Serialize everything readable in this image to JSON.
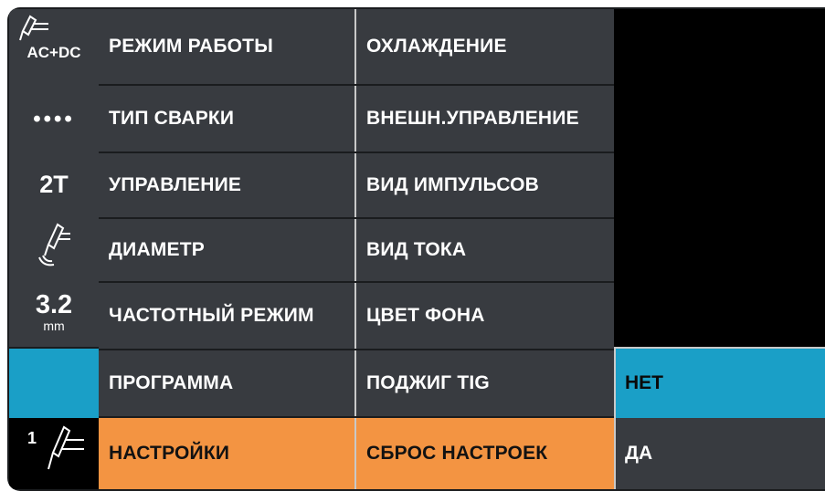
{
  "sidebar": {
    "mode_label": "AC+DC",
    "dots_label": "••••",
    "trigger_label": "2T",
    "diameter_value": "3.2",
    "diameter_unit": "mm",
    "program_number": "1"
  },
  "menu": {
    "col1": [
      "РЕЖИМ РАБОТЫ",
      "ТИП СВАРКИ",
      "УПРАВЛЕНИЕ",
      "ДИАМЕТР",
      "ЧАСТОТНЫЙ РЕЖИМ",
      "ПРОГРАММА",
      "НАСТРОЙКИ"
    ],
    "col2": [
      "ОХЛАЖДЕНИЕ",
      "ВНЕШН.УПРАВЛЕНИЕ",
      "ВИД ИМПУЛЬСОВ",
      "ВИД ТОКА",
      "ЦВЕТ ФОНА",
      "ПОДЖИГ TIG",
      "СБРОС НАСТРОЕК"
    ],
    "col3": [
      "НЕТ",
      "ДА"
    ]
  },
  "colors": {
    "panel": "#383b40",
    "selected": "#f39442",
    "highlight": "#1a9fc7",
    "background": "#1a1c1e"
  }
}
